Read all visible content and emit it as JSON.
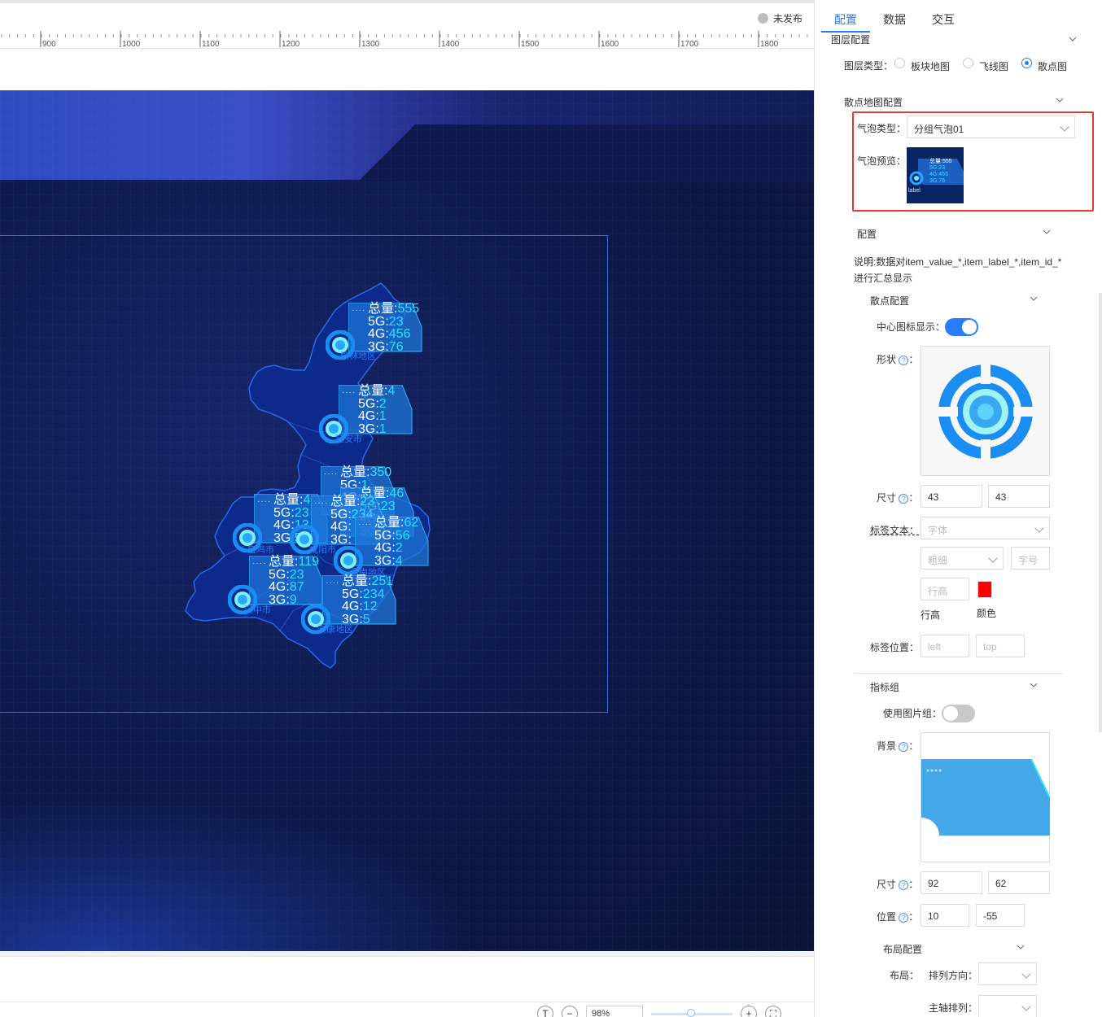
{
  "status": {
    "label": "未发布",
    "color": "#bdbdbd"
  },
  "ruler": {
    "labels": [
      "900",
      "1000",
      "1100",
      "1200",
      "1300",
      "1400",
      "1500",
      "1600",
      "1700",
      "1800"
    ]
  },
  "zoom": {
    "value": "98%",
    "zoom_out": "−",
    "zoom_in": "+",
    "fit": "T"
  },
  "map": {
    "bubbles": [
      {
        "total_label": "总量:",
        "total": "555",
        "rows": [
          [
            "5G:",
            "23"
          ],
          [
            "4G:",
            "456"
          ],
          [
            "3G:",
            "76"
          ]
        ],
        "region": "榆林地区"
      },
      {
        "total_label": "总量:",
        "total": "4",
        "rows": [
          [
            "5G:",
            "2"
          ],
          [
            "4G:",
            "1"
          ],
          [
            "3G:",
            "1"
          ]
        ],
        "region": "延安市"
      },
      {
        "total_label": "总量:",
        "total": "350",
        "rows": [
          [
            "5G:",
            "1"
          ],
          [
            "4G:",
            ""
          ],
          [
            "3G:",
            ""
          ]
        ],
        "region": ""
      },
      {
        "total_label": "总量:",
        "total": "4",
        "rows": [
          [
            "5G:",
            "23"
          ],
          [
            "4G:",
            "13"
          ],
          [
            "3G:",
            "5"
          ]
        ],
        "region": "宝鸡市"
      },
      {
        "total_label": "总量:",
        "total": "46",
        "rows": [
          [
            "5G:",
            "23"
          ],
          [
            "4G:",
            ""
          ],
          [
            "3G:",
            ""
          ]
        ],
        "region": ""
      },
      {
        "total_label": "总量:",
        "total": "23",
        "rows": [
          [
            "5G:",
            "234"
          ],
          [
            "4G:",
            ""
          ],
          [
            "3G:",
            ""
          ]
        ],
        "region": "咸阳市"
      },
      {
        "total_label": "总量:",
        "total": "62",
        "rows": [
          [
            "5G:",
            "56"
          ],
          [
            "4G:",
            "2"
          ],
          [
            "3G:",
            "4"
          ]
        ],
        "region": "渭南地区"
      },
      {
        "total_label": "总量:",
        "total": "119",
        "rows": [
          [
            "5G:",
            "23"
          ],
          [
            "4G:",
            "87"
          ],
          [
            "3G:",
            "9"
          ]
        ],
        "region": "汉中市"
      },
      {
        "total_label": "总量:",
        "total": "251",
        "rows": [
          [
            "5G:",
            "234"
          ],
          [
            "4G:",
            "12"
          ],
          [
            "3G:",
            "5"
          ]
        ],
        "region": "安康地区"
      }
    ]
  },
  "panel": {
    "tabs": [
      "配置",
      "数据",
      "交互"
    ],
    "layer_section": "图层配置",
    "layer_type_label": "图层类型：",
    "layer_types": [
      "板块地图",
      "飞线图",
      "散点图"
    ],
    "scatter_section": "散点地图配置",
    "bubble_type_label": "气泡类型：",
    "bubble_type_value": "分组气泡01",
    "bubble_preview_label": "气泡预览：",
    "preview": {
      "rows": [
        "总量:555",
        "5G:23",
        "4G:456",
        "3G:76"
      ],
      "label": "label"
    },
    "config_section": "配置",
    "note": "说明:数据对item_value_*,item_label_*,item_id_*进行汇总显示",
    "scatter_config": "散点配置",
    "center_icon_label": "中心图标显示：",
    "shape_label": "形状",
    "size_label": "尺寸",
    "size_w": "43",
    "size_h": "43",
    "label_text_label": "标签文本：",
    "font_placeholder": "字体",
    "weight_placeholder": "粗细",
    "fontsize_placeholder": "字号",
    "lineheight_placeholder": "行高",
    "lineheight_label": "行高",
    "color_label": "颜色",
    "label_color": "#ff0000",
    "label_pos_label": "标签位置：",
    "left_placeholder": "left",
    "top_placeholder": "top",
    "indicator_section": "指标组",
    "use_image_group_label": "使用图片组：",
    "background_label": "背景",
    "bg_size_label": "尺寸",
    "bg_w": "92",
    "bg_h": "62",
    "position_label": "位置",
    "pos_x": "10",
    "pos_y": "-55",
    "layout_section": "布局配置",
    "layout_label": "布局：",
    "direction_label": "排列方向：",
    "main_axis_label": "主轴排列："
  }
}
